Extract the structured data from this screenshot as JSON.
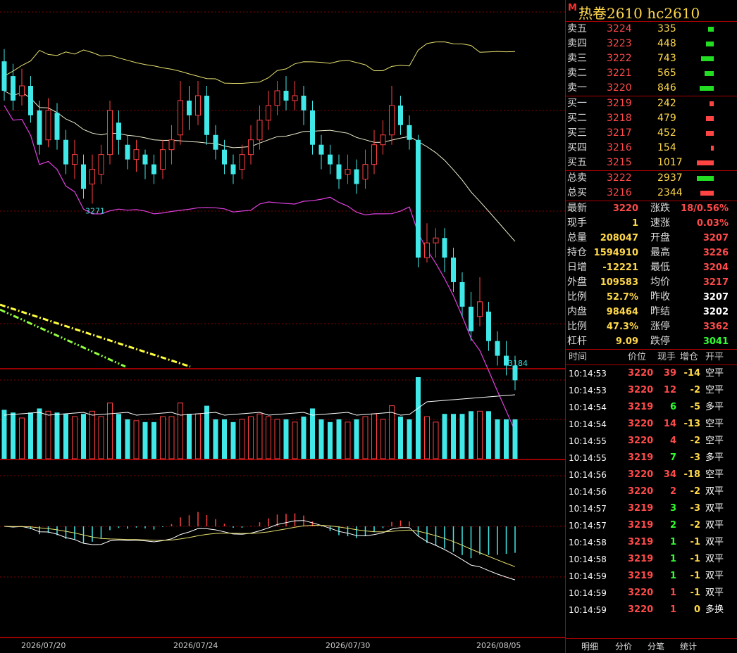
{
  "header": {
    "marker": "M",
    "title": "热卷2610  hc2610"
  },
  "asks": [
    {
      "label": "卖五",
      "price": "3224",
      "vol": "335",
      "bar": 0.33
    },
    {
      "label": "卖四",
      "price": "3223",
      "vol": "448",
      "bar": 0.44
    },
    {
      "label": "卖三",
      "price": "3222",
      "vol": "743",
      "bar": 0.73
    },
    {
      "label": "卖二",
      "price": "3221",
      "vol": "565",
      "bar": 0.56
    },
    {
      "label": "卖一",
      "price": "3220",
      "vol": "846",
      "bar": 0.83
    }
  ],
  "bids": [
    {
      "label": "买一",
      "price": "3219",
      "vol": "242",
      "bar": 0.24
    },
    {
      "label": "买二",
      "price": "3218",
      "vol": "479",
      "bar": 0.47
    },
    {
      "label": "买三",
      "price": "3217",
      "vol": "452",
      "bar": 0.44
    },
    {
      "label": "买四",
      "price": "3216",
      "vol": "154",
      "bar": 0.15
    },
    {
      "label": "买五",
      "price": "3215",
      "vol": "1017",
      "bar": 1.0
    }
  ],
  "totals": [
    {
      "label": "总卖",
      "price": "3222",
      "vol": "2937",
      "bar": 1.0,
      "color": "#22dd22"
    },
    {
      "label": "总买",
      "price": "3216",
      "vol": "2344",
      "bar": 0.8,
      "color": "#ff4444"
    }
  ],
  "stats": [
    {
      "l1": "最新",
      "v1": "3220",
      "c1": "red",
      "l2": "涨跌",
      "v2": "18/0.56%",
      "c2": "red"
    },
    {
      "l1": "现手",
      "v1": "1",
      "c1": "yel",
      "l2": "速涨",
      "v2": "0.03%",
      "c2": "red"
    },
    {
      "l1": "总量",
      "v1": "208047",
      "c1": "yel",
      "l2": "开盘",
      "v2": "3207",
      "c2": "red"
    },
    {
      "l1": "持仓",
      "v1": "1594910",
      "c1": "yel",
      "l2": "最高",
      "v2": "3226",
      "c2": "red"
    },
    {
      "l1": "日增",
      "v1": "-12221",
      "c1": "yel",
      "l2": "最低",
      "v2": "3204",
      "c2": "red"
    },
    {
      "l1": "外盘",
      "v1": "109583",
      "c1": "yel",
      "l2": "均价",
      "v2": "3217",
      "c2": "red"
    },
    {
      "l1": "比例",
      "v1": "52.7%",
      "c1": "yel",
      "l2": "昨收",
      "v2": "3207",
      "c2": "wht"
    },
    {
      "l1": "内盘",
      "v1": "98464",
      "c1": "yel",
      "l2": "昨结",
      "v2": "3202",
      "c2": "wht"
    },
    {
      "l1": "比例",
      "v1": "47.3%",
      "c1": "yel",
      "l2": "涨停",
      "v2": "3362",
      "c2": "red"
    },
    {
      "l1": "杠杆",
      "v1": "9.09",
      "c1": "yel",
      "l2": "跌停",
      "v2": "3041",
      "c2": "grn"
    }
  ],
  "ticks_header": {
    "time": "时间",
    "price": "价位",
    "hand": "现手",
    "oi": "增仓",
    "type": "开平"
  },
  "ticks": [
    {
      "time": "10:14:53",
      "price": "3220",
      "hand": "39",
      "hc": "red",
      "oi": "-14",
      "type": "空平"
    },
    {
      "time": "10:14:53",
      "price": "3220",
      "hand": "12",
      "hc": "red",
      "oi": "-2",
      "type": "空平"
    },
    {
      "time": "10:14:54",
      "price": "3219",
      "hand": "6",
      "hc": "grn",
      "oi": "-5",
      "type": "多平"
    },
    {
      "time": "10:14:54",
      "price": "3220",
      "hand": "14",
      "hc": "red",
      "oi": "-13",
      "type": "空平"
    },
    {
      "time": "10:14:55",
      "price": "3220",
      "hand": "4",
      "hc": "red",
      "oi": "-2",
      "type": "空平"
    },
    {
      "time": "10:14:55",
      "price": "3219",
      "hand": "7",
      "hc": "grn",
      "oi": "-3",
      "type": "多平"
    },
    {
      "time": "10:14:56",
      "price": "3220",
      "hand": "34",
      "hc": "red",
      "oi": "-18",
      "type": "空平"
    },
    {
      "time": "10:14:56",
      "price": "3220",
      "hand": "2",
      "hc": "red",
      "oi": "-2",
      "type": "双平"
    },
    {
      "time": "10:14:57",
      "price": "3219",
      "hand": "3",
      "hc": "grn",
      "oi": "-3",
      "type": "双平"
    },
    {
      "time": "10:14:57",
      "price": "3219",
      "hand": "2",
      "hc": "grn",
      "oi": "-2",
      "type": "双平"
    },
    {
      "time": "10:14:58",
      "price": "3219",
      "hand": "1",
      "hc": "grn",
      "oi": "-1",
      "type": "双平"
    },
    {
      "time": "10:14:58",
      "price": "3219",
      "hand": "1",
      "hc": "grn",
      "oi": "-1",
      "type": "双平"
    },
    {
      "time": "10:14:59",
      "price": "3219",
      "hand": "1",
      "hc": "grn",
      "oi": "-1",
      "type": "双平"
    },
    {
      "time": "10:14:59",
      "price": "3220",
      "hand": "1",
      "hc": "red",
      "oi": "-1",
      "type": "双平"
    },
    {
      "time": "10:14:59",
      "price": "3220",
      "hand": "1",
      "hc": "red",
      "oi": "0",
      "type": "多换"
    }
  ],
  "tabs": [
    "明细",
    "分价",
    "分笔",
    "统计"
  ],
  "chart_data": {
    "type": "candlestick",
    "x_ticks": [
      "2026/07/20",
      "2026/07/24",
      "2026/07/30",
      "2026/08/05"
    ],
    "annotations": [
      {
        "text": "3271"
      },
      {
        "text": "3184"
      }
    ],
    "ylim": [
      3175,
      3325
    ],
    "candles": [
      [
        3300,
        3288,
        3305,
        3284
      ],
      [
        3294,
        3284,
        3299,
        3280
      ],
      [
        3286,
        3290,
        3297,
        3282
      ],
      [
        3290,
        3278,
        3294,
        3275
      ],
      [
        3280,
        3266,
        3284,
        3262
      ],
      [
        3268,
        3280,
        3285,
        3265
      ],
      [
        3279,
        3268,
        3283,
        3264
      ],
      [
        3268,
        3258,
        3272,
        3254
      ],
      [
        3258,
        3262,
        3268,
        3252
      ],
      [
        3258,
        3248,
        3262,
        3244
      ],
      [
        3250,
        3256,
        3262,
        3242
      ],
      [
        3254,
        3262,
        3266,
        3250
      ],
      [
        3262,
        3280,
        3284,
        3258
      ],
      [
        3275,
        3268,
        3280,
        3262
      ],
      [
        3266,
        3260,
        3270,
        3256
      ],
      [
        3260,
        3264,
        3268,
        3255
      ],
      [
        3262,
        3258,
        3264,
        3252
      ],
      [
        3258,
        3254,
        3262,
        3250
      ],
      [
        3256,
        3264,
        3268,
        3252
      ],
      [
        3264,
        3268,
        3274,
        3258
      ],
      [
        3270,
        3284,
        3292,
        3266
      ],
      [
        3284,
        3278,
        3290,
        3272
      ],
      [
        3278,
        3286,
        3292,
        3274
      ],
      [
        3286,
        3270,
        3290,
        3266
      ],
      [
        3270,
        3264,
        3274,
        3260
      ],
      [
        3264,
        3258,
        3268,
        3254
      ],
      [
        3258,
        3254,
        3262,
        3250
      ],
      [
        3256,
        3262,
        3266,
        3252
      ],
      [
        3262,
        3268,
        3274,
        3258
      ],
      [
        3268,
        3276,
        3282,
        3264
      ],
      [
        3276,
        3282,
        3288,
        3272
      ],
      [
        3282,
        3288,
        3292,
        3278
      ],
      [
        3288,
        3284,
        3294,
        3280
      ],
      [
        3284,
        3286,
        3292,
        3280
      ],
      [
        3286,
        3280,
        3290,
        3274
      ],
      [
        3280,
        3266,
        3284,
        3262
      ],
      [
        3266,
        3262,
        3270,
        3256
      ],
      [
        3262,
        3258,
        3266,
        3254
      ],
      [
        3258,
        3252,
        3262,
        3248
      ],
      [
        3254,
        3256,
        3262,
        3250
      ],
      [
        3256,
        3250,
        3260,
        3246
      ],
      [
        3252,
        3258,
        3264,
        3248
      ],
      [
        3258,
        3266,
        3272,
        3254
      ],
      [
        3266,
        3270,
        3276,
        3262
      ],
      [
        3270,
        3282,
        3290,
        3266
      ],
      [
        3282,
        3274,
        3286,
        3270
      ],
      [
        3274,
        3268,
        3278,
        3264
      ],
      [
        3268,
        3220,
        3270,
        3216
      ],
      [
        3220,
        3226,
        3234,
        3218
      ],
      [
        3226,
        3228,
        3232,
        3220
      ],
      [
        3228,
        3220,
        3232,
        3214
      ],
      [
        3220,
        3210,
        3224,
        3206
      ],
      [
        3210,
        3200,
        3214,
        3196
      ],
      [
        3200,
        3190,
        3206,
        3186
      ],
      [
        3196,
        3202,
        3212,
        3192
      ],
      [
        3198,
        3186,
        3202,
        3182
      ],
      [
        3186,
        3180,
        3190,
        3176
      ],
      [
        3180,
        3176,
        3186,
        3172
      ],
      [
        3176,
        3170,
        3180,
        3166
      ]
    ]
  }
}
